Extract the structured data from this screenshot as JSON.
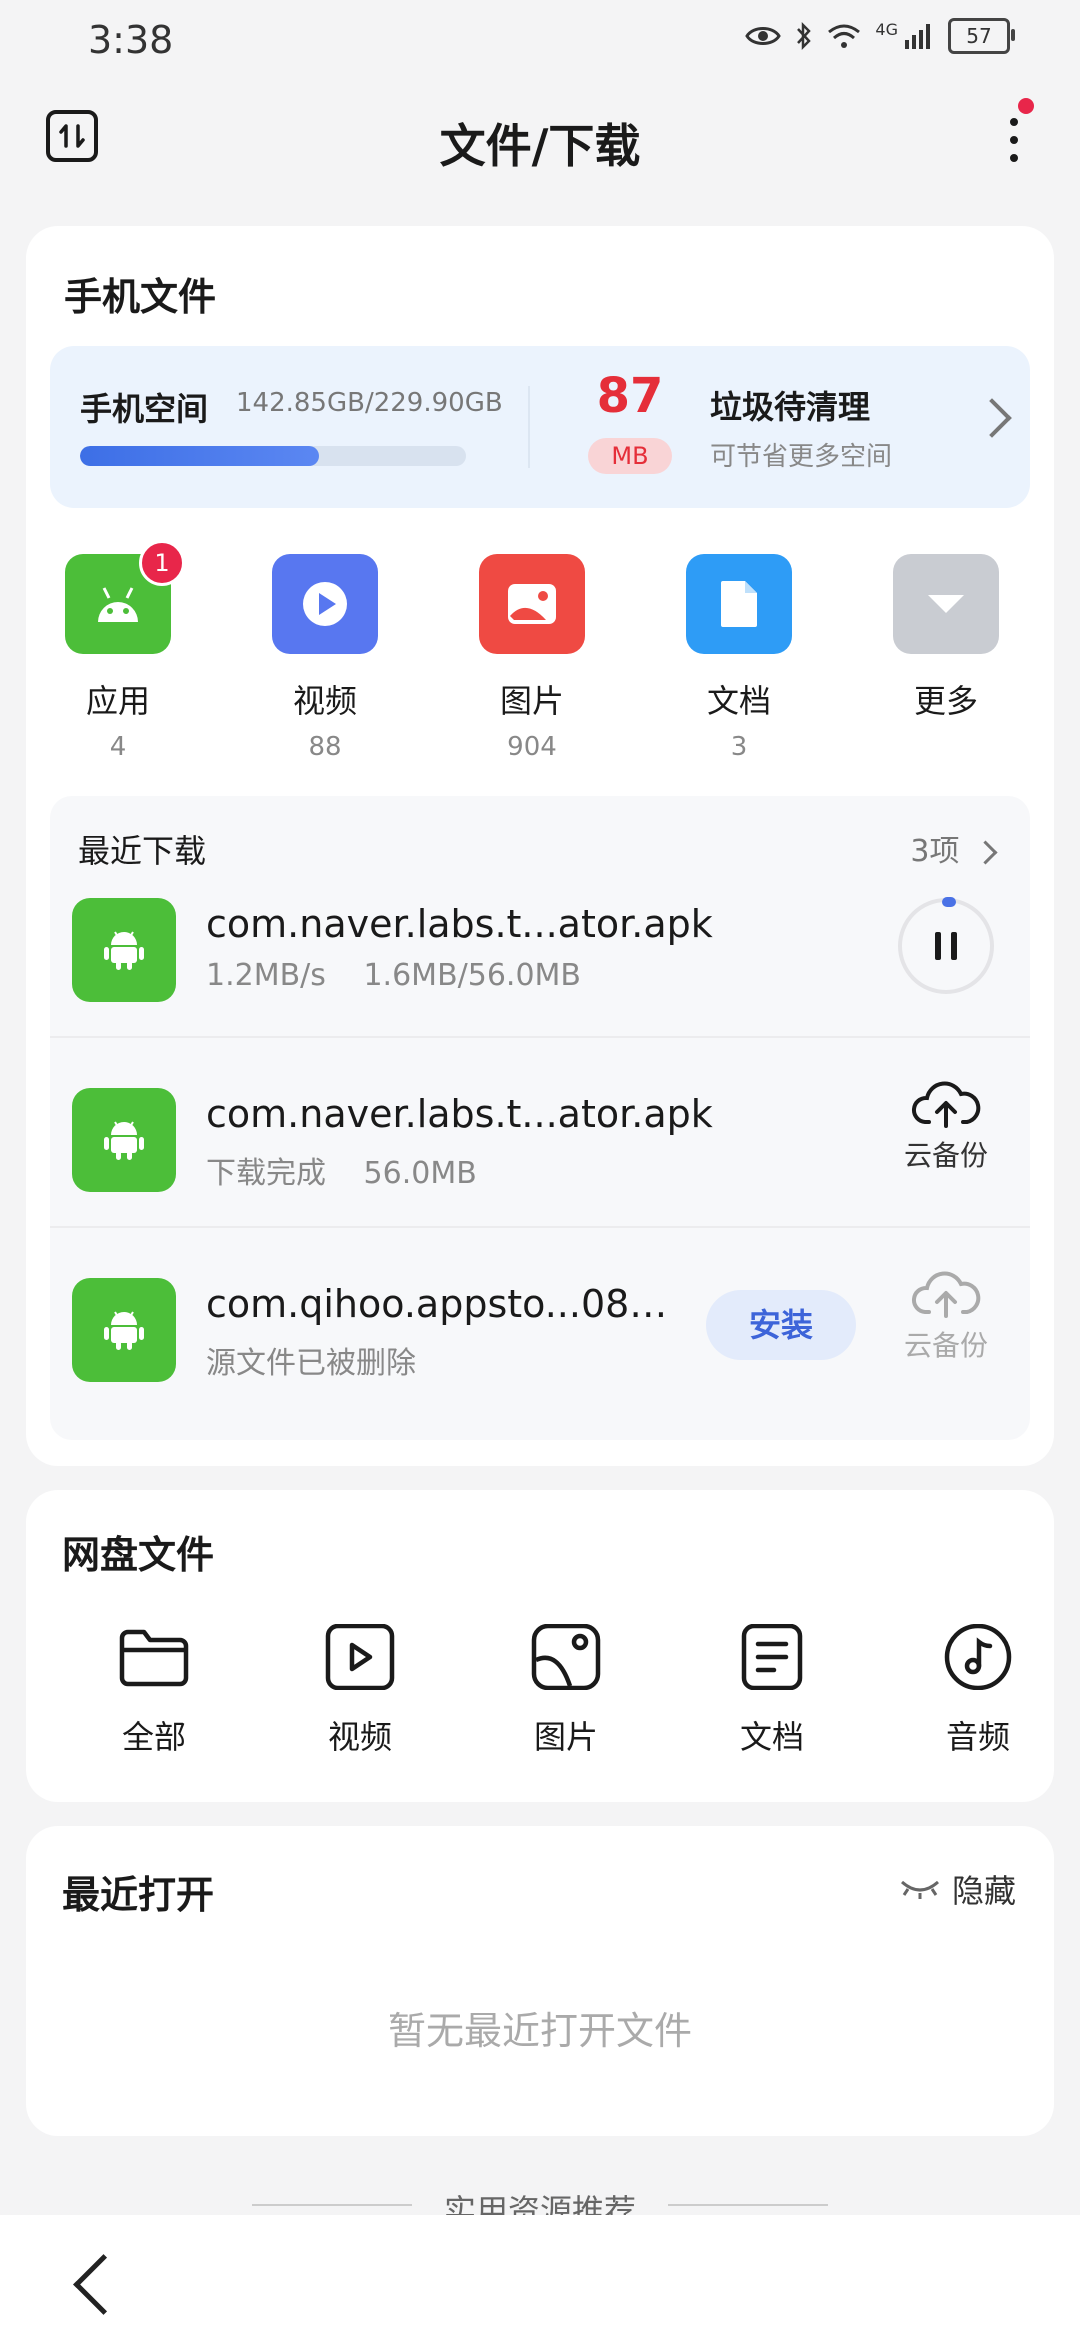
{
  "status_bar": {
    "time": "3:38",
    "network": "4G",
    "battery": "57"
  },
  "header": {
    "title": "文件/下载"
  },
  "phone_files": {
    "title": "手机文件",
    "storage": {
      "label": "手机空间",
      "size": "142.85GB/229.90GB",
      "used_fraction": 0.62
    },
    "junk": {
      "amount": "87",
      "unit": "MB",
      "title": "垃圾待清理",
      "subtitle": "可节省更多空间"
    },
    "categories": [
      {
        "label": "应用",
        "count": "4",
        "badge": "1",
        "icon": "android-icon",
        "color": "#4cbe39"
      },
      {
        "label": "视频",
        "count": "88",
        "icon": "play-icon",
        "color": "#5877f0"
      },
      {
        "label": "图片",
        "count": "904",
        "icon": "image-icon",
        "color": "#ef4a43"
      },
      {
        "label": "文档",
        "count": "3",
        "icon": "document-icon",
        "color": "#2e9cf6"
      },
      {
        "label": "更多",
        "icon": "chevron-down-icon",
        "color": "#c9ccd2"
      }
    ]
  },
  "recent_downloads": {
    "title": "最近下载",
    "count": "3项",
    "items": [
      {
        "name": "com.naver.labs.t...ator.apk",
        "speed": "1.2MB/s",
        "progress": "1.6MB/56.0MB",
        "action": "pause"
      },
      {
        "name": "com.naver.labs.t...ator.apk",
        "status": "下载完成",
        "size": "56.0MB",
        "action_label": "云备份"
      },
      {
        "name": "com.qihoo.appsto...08…",
        "status": "源文件已被删除",
        "install_label": "安装",
        "action_label": "云备份"
      }
    ]
  },
  "netdisk": {
    "title": "网盘文件",
    "items": [
      {
        "label": "全部",
        "icon": "folder-icon"
      },
      {
        "label": "视频",
        "icon": "video-icon"
      },
      {
        "label": "图片",
        "icon": "image-icon"
      },
      {
        "label": "文档",
        "icon": "document-icon"
      },
      {
        "label": "音频",
        "icon": "music-note-icon"
      }
    ]
  },
  "recent_open": {
    "title": "最近打开",
    "hide_label": "隐藏",
    "empty_text": "暂无最近打开文件"
  },
  "footer": {
    "partial_label": "实用资源推荐"
  }
}
